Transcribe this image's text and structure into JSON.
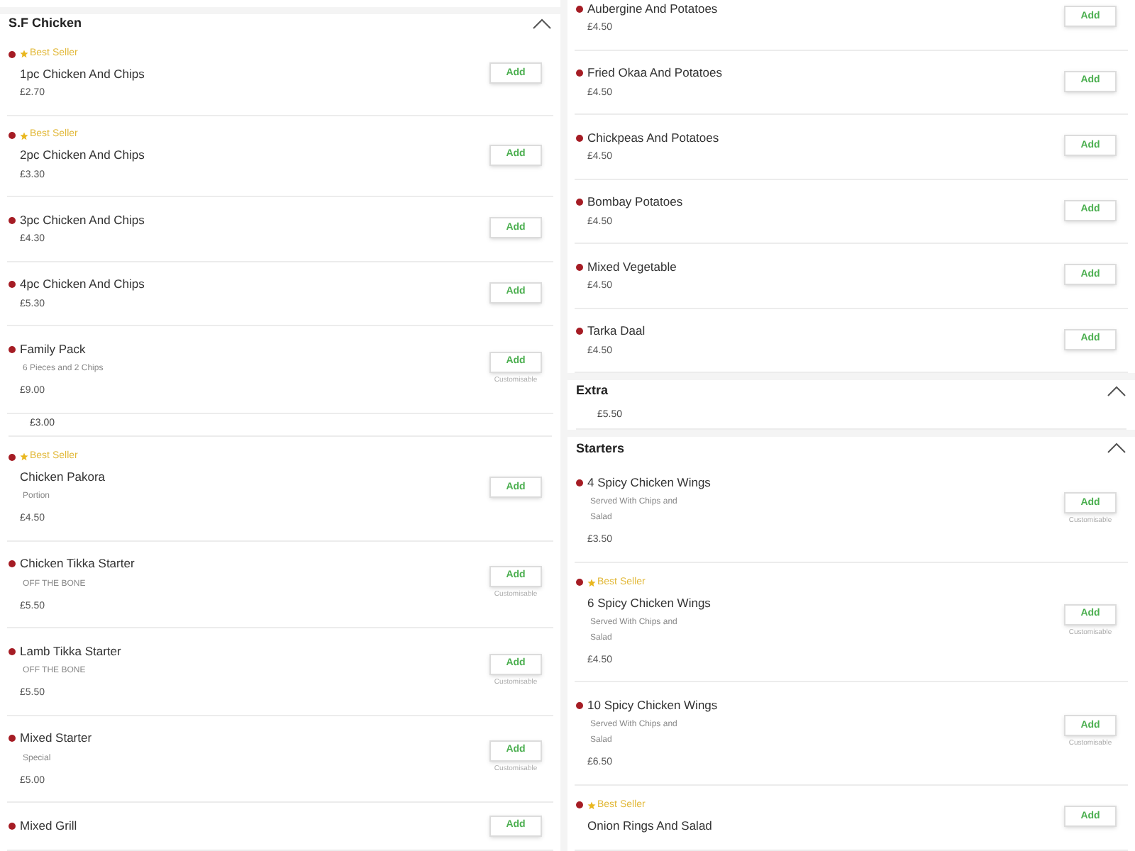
{
  "columns": [
    {
      "blocks": [
        {
          "kind": "section",
          "title": "S.F Chicken",
          "expanded": true
        },
        {
          "kind": "item",
          "best_seller": "Best Seller",
          "name": "1pc Chicken And Chips",
          "price": "£2.70",
          "button": "Add"
        },
        {
          "kind": "item",
          "best_seller": "Best Seller",
          "name": "2pc Chicken And Chips",
          "price": "£3.30",
          "button": "Add"
        },
        {
          "kind": "item",
          "name": "3pc Chicken And Chips",
          "price": "£4.30",
          "button": "Add"
        },
        {
          "kind": "item",
          "name": "4pc Chicken And Chips",
          "price": "£5.30",
          "button": "Add"
        },
        {
          "kind": "item",
          "name": "Family Pack",
          "description": "6 Pieces and 2 Chips",
          "price": "£9.00",
          "button": "Add",
          "note": "Customisable"
        },
        {
          "kind": "price_only",
          "price": "£3.00"
        },
        {
          "kind": "item",
          "best_seller": "Best Seller",
          "name": "Chicken Pakora",
          "description": "Portion",
          "price": "£4.50",
          "button": "Add"
        },
        {
          "kind": "item",
          "name": "Chicken Tikka Starter",
          "description": "OFF THE BONE",
          "price": "£5.50",
          "button": "Add",
          "note": "Customisable"
        },
        {
          "kind": "item",
          "name": "Lamb Tikka Starter",
          "description": "OFF THE BONE",
          "price": "£5.50",
          "button": "Add",
          "note": "Customisable"
        },
        {
          "kind": "item",
          "name": "Mixed Starter",
          "description": "Special",
          "price": "£5.00",
          "button": "Add",
          "note": "Customisable"
        },
        {
          "kind": "item",
          "name": "Mixed Grill",
          "button": "Add"
        }
      ]
    },
    {
      "blocks": [
        {
          "kind": "item",
          "name": "Aubergine And Potatoes",
          "price": "£4.50",
          "button": "Add"
        },
        {
          "kind": "item",
          "name": "Fried Okaa And Potatoes",
          "price": "£4.50",
          "button": "Add"
        },
        {
          "kind": "item",
          "name": "Chickpeas And Potatoes",
          "price": "£4.50",
          "button": "Add"
        },
        {
          "kind": "item",
          "name": "Bombay Potatoes",
          "price": "£4.50",
          "button": "Add"
        },
        {
          "kind": "item",
          "name": "Mixed Vegetable",
          "price": "£4.50",
          "button": "Add"
        },
        {
          "kind": "item",
          "name": "Tarka Daal",
          "price": "£4.50",
          "button": "Add"
        },
        {
          "kind": "section",
          "title": "Extra",
          "expanded": true
        },
        {
          "kind": "price_only",
          "price": "£5.50"
        },
        {
          "kind": "section",
          "title": "Starters",
          "expanded": true
        },
        {
          "kind": "item",
          "name": "4 Spicy Chicken Wings",
          "description": "Served With Chips and Salad",
          "price": "£3.50",
          "button": "Add",
          "note": "Customisable"
        },
        {
          "kind": "item",
          "best_seller": "Best Seller",
          "name": "6 Spicy Chicken Wings",
          "description": "Served With Chips and Salad",
          "price": "£4.50",
          "button": "Add",
          "note": "Customisable"
        },
        {
          "kind": "item",
          "name": "10 Spicy Chicken Wings",
          "description": "Served With Chips and Salad",
          "price": "£6.50",
          "button": "Add",
          "note": "Customisable"
        },
        {
          "kind": "item",
          "best_seller": "Best Seller",
          "name": "Onion Rings And Salad",
          "button": "Add"
        }
      ]
    }
  ]
}
